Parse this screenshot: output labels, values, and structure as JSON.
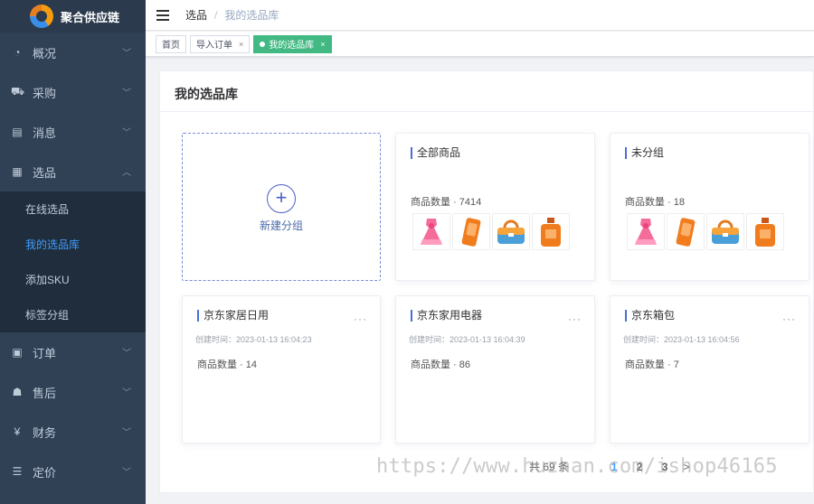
{
  "app": {
    "name": "聚合供应链"
  },
  "sidebar": {
    "items": [
      {
        "label": "概况",
        "icon": "dashboard-icon",
        "glyph": "◔"
      },
      {
        "label": "采购",
        "icon": "cart-icon",
        "glyph": "⛟"
      },
      {
        "label": "消息",
        "icon": "message-icon",
        "glyph": "▤"
      },
      {
        "label": "选品",
        "icon": "grid-icon",
        "glyph": "▦"
      }
    ],
    "submenu": [
      {
        "label": "在线选品"
      },
      {
        "label": "我的选品库"
      },
      {
        "label": "添加SKU"
      },
      {
        "label": "标签分组"
      }
    ],
    "items_after": [
      {
        "label": "订单",
        "icon": "order-icon",
        "glyph": "▣"
      },
      {
        "label": "售后",
        "icon": "users-icon",
        "glyph": "☗"
      },
      {
        "label": "财务",
        "icon": "yen-icon",
        "glyph": "¥"
      },
      {
        "label": "定价",
        "icon": "list-icon",
        "glyph": "☰"
      }
    ]
  },
  "breadcrumb": {
    "first": "选品",
    "sep": "/",
    "last": "我的选品库"
  },
  "tags": [
    {
      "label": "首页"
    },
    {
      "label": "导入订单",
      "close": "×"
    },
    {
      "label": "我的选品库",
      "close": "×"
    }
  ],
  "main": {
    "title": "我的选品库",
    "new_group": {
      "plus": "+",
      "label": "新建分组"
    },
    "groups": [
      {
        "title": "全部商品",
        "count": "商品数量 · 7414"
      },
      {
        "title": "未分组",
        "count": "商品数量 · 18"
      },
      {
        "title": "京东家居日用",
        "time": "创建时间：2023-01-13 16:04:23",
        "count": "商品数量 · 14",
        "more": "···"
      },
      {
        "title": "京东家用电器",
        "time": "创建时间：2023-01-13 16:04:39",
        "count": "商品数量 · 86",
        "more": "···"
      },
      {
        "title": "京东箱包",
        "time": "创建时间：2023-01-13 16:04:56",
        "count": "商品数量 · 7",
        "more": "···"
      }
    ],
    "thumb_icons": [
      "dress-icon",
      "phone-case-icon",
      "bag-icon",
      "perfume-icon"
    ]
  },
  "pagination": {
    "total": "共 69 条",
    "pages": [
      "1",
      "2",
      "3"
    ],
    "next": ">"
  },
  "watermark": "https://www.huzhan.com/ishop46165",
  "colors": {
    "sidebar": "#304156",
    "active_link": "#409eff",
    "active_tag": "#42b983",
    "accent": "#4b6ed6"
  }
}
